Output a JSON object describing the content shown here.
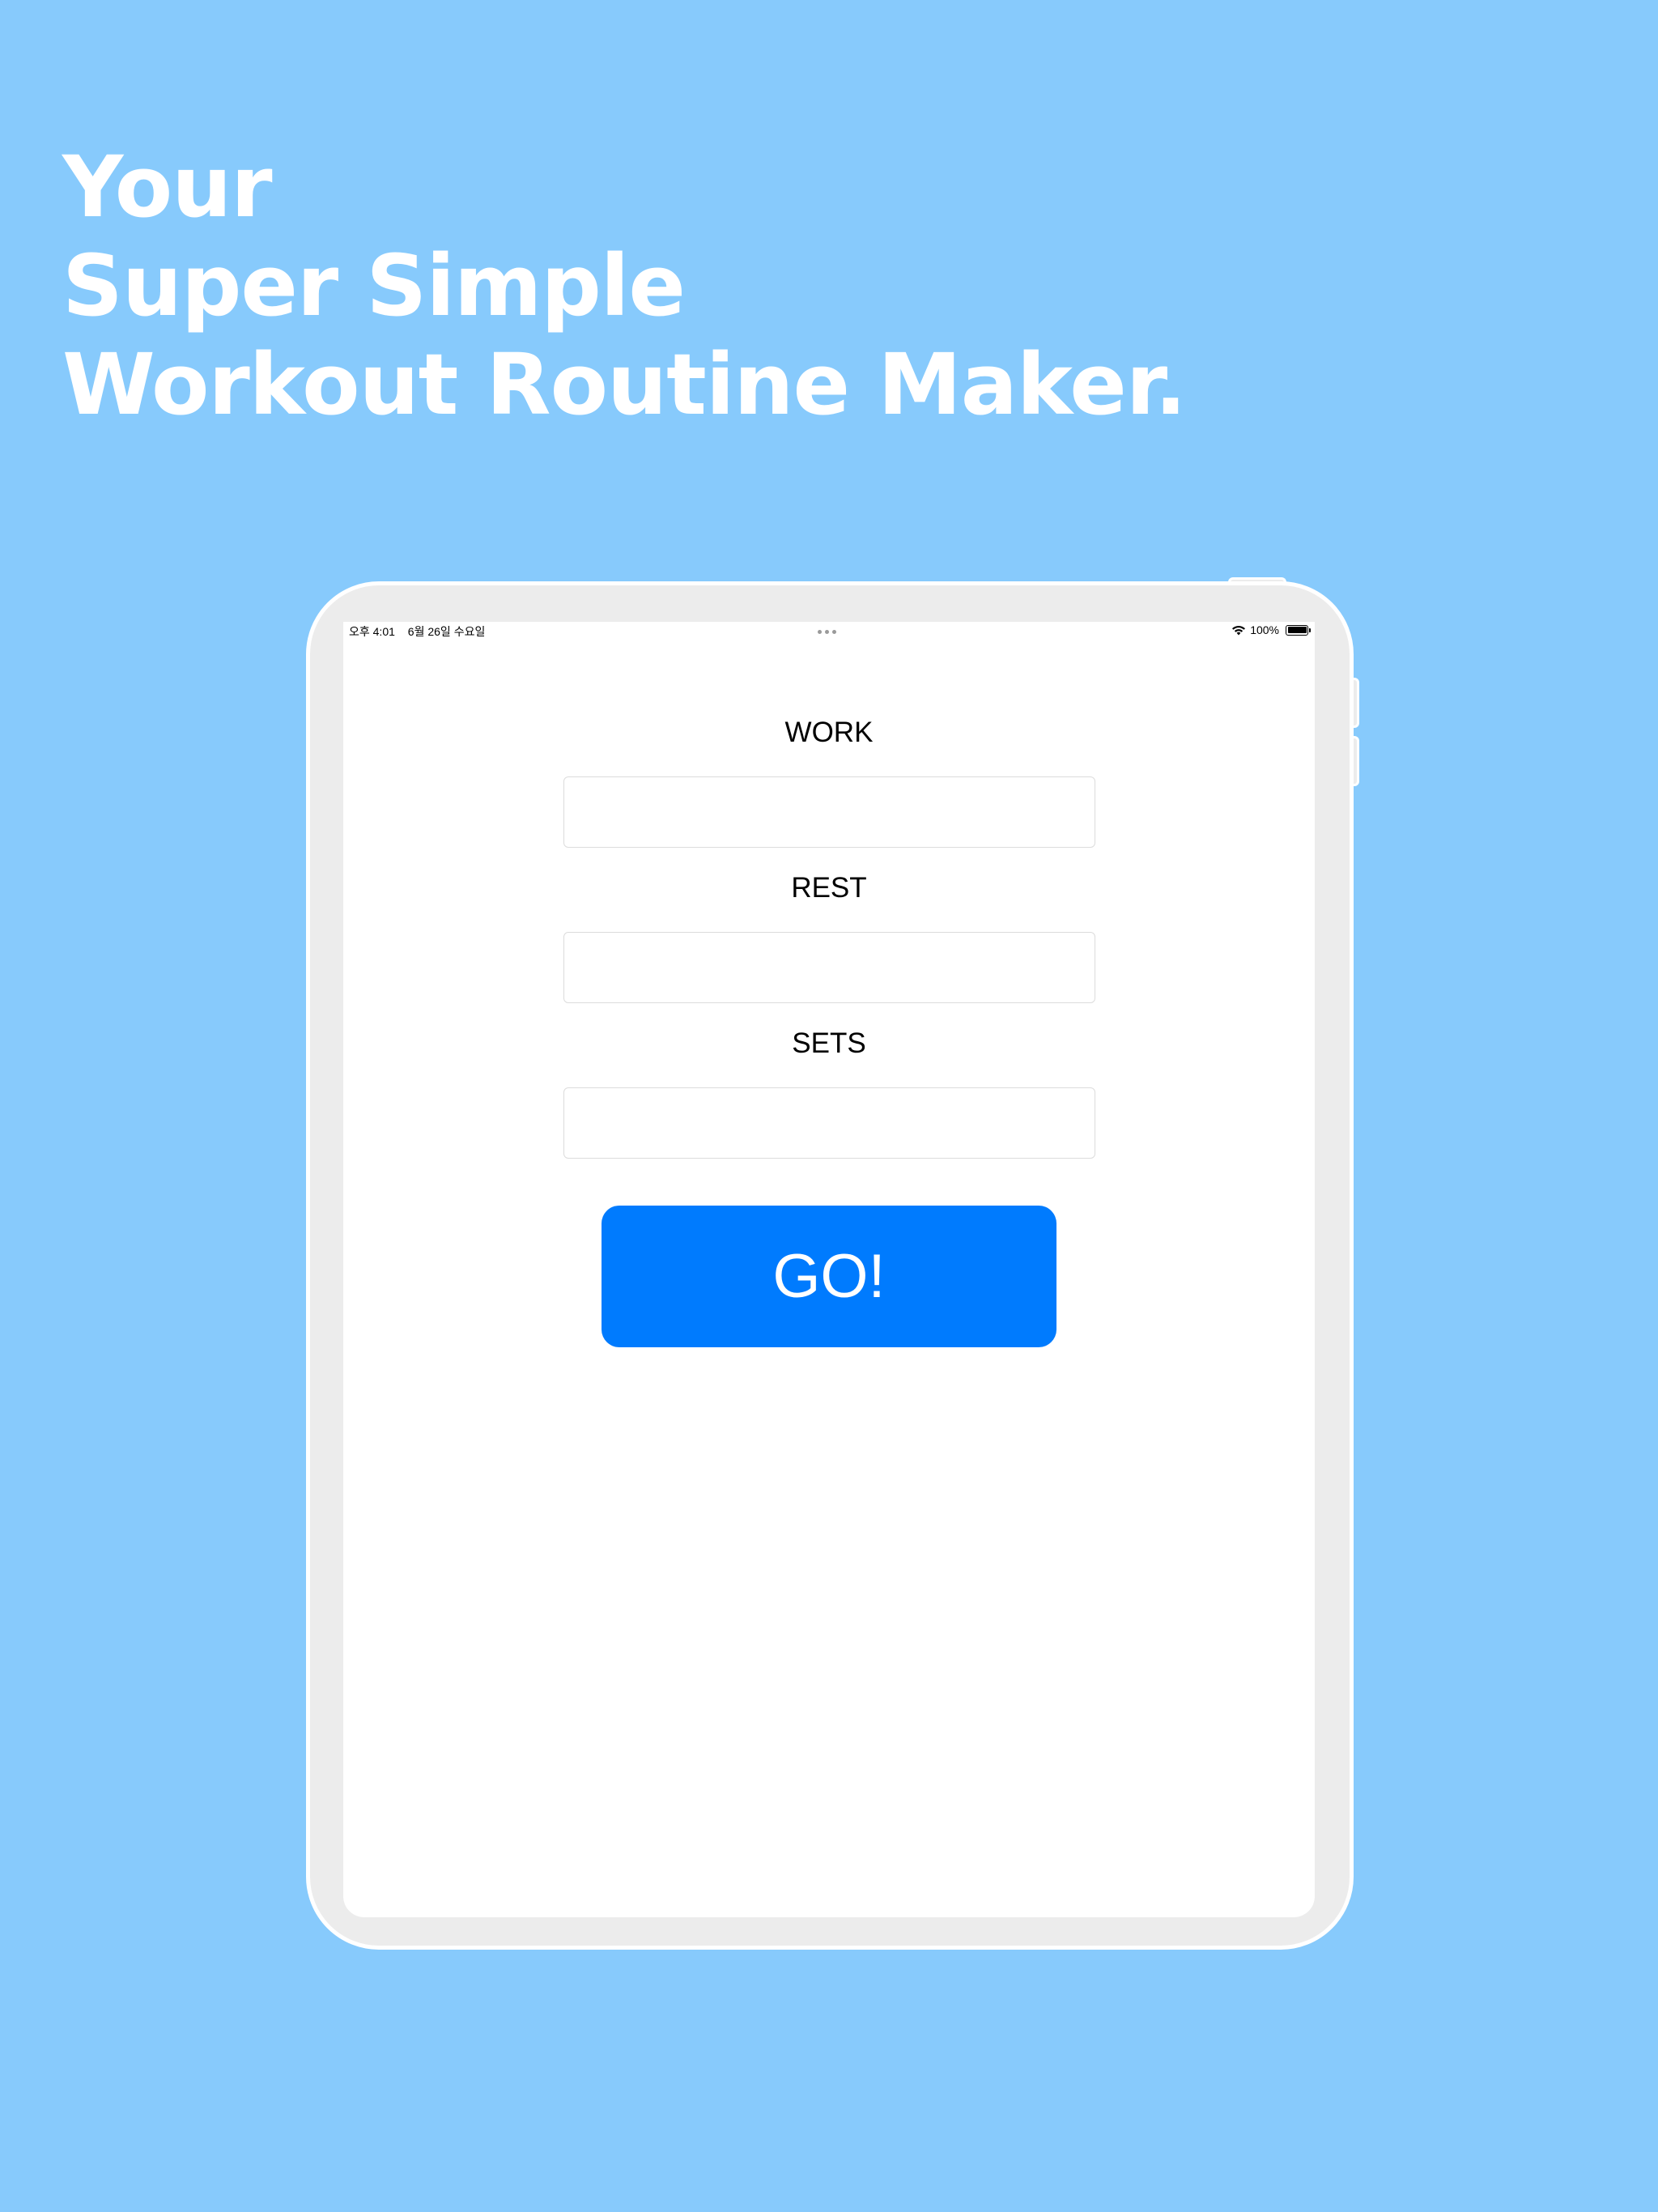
{
  "headline": {
    "line1": "Your",
    "line2": "Super Simple",
    "line3": "Workout Routine Maker."
  },
  "status_bar": {
    "time": "오후 4:01",
    "date": "6월 26일 수요일",
    "battery": "100%",
    "wifi_icon": "wifi-icon",
    "battery_icon": "battery-icon"
  },
  "form": {
    "work_label": "WORK",
    "work_value": "",
    "rest_label": "REST",
    "rest_value": "",
    "sets_label": "SETS",
    "sets_value": "",
    "go_label": "GO!"
  },
  "colors": {
    "background": "#87CAFC",
    "button": "#007BFE",
    "device_frame": "#ECECEC"
  }
}
